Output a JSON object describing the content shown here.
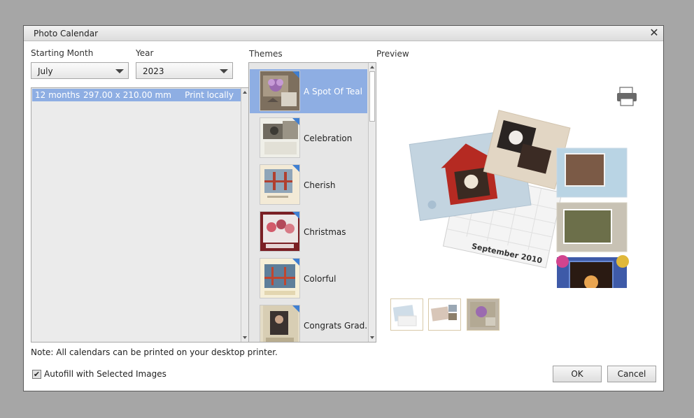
{
  "dialog": {
    "title": "Photo Calendar",
    "close_glyph": "✕"
  },
  "labels": {
    "starting_month": "Starting Month",
    "year": "Year",
    "themes": "Themes",
    "preview": "Preview"
  },
  "month_select": {
    "value": "July"
  },
  "year_select": {
    "value": "2023"
  },
  "sizes": [
    {
      "months": "12 months",
      "dimensions": "297.00 x 210.00 mm",
      "print": "Print locally"
    }
  ],
  "themes": [
    {
      "name": "A Spot Of Teal",
      "selected": true
    },
    {
      "name": "Celebration",
      "selected": false
    },
    {
      "name": "Cherish",
      "selected": false
    },
    {
      "name": "Christmas",
      "selected": false
    },
    {
      "name": "Colorful",
      "selected": false
    },
    {
      "name": "Congrats Grad...",
      "selected": false
    }
  ],
  "preview_graphics": {
    "calendar_caption": "September 2010",
    "icon": "print-icon"
  },
  "note": "Note: All calendars can be printed on your desktop printer.",
  "autofill": {
    "label": "Autofill with Selected Images",
    "checked": true,
    "check_glyph": "✔"
  },
  "buttons": {
    "ok": "OK",
    "cancel": "Cancel"
  },
  "colors": {
    "selection": "#8eaee3",
    "corner_badge": "#3f7fd2"
  }
}
